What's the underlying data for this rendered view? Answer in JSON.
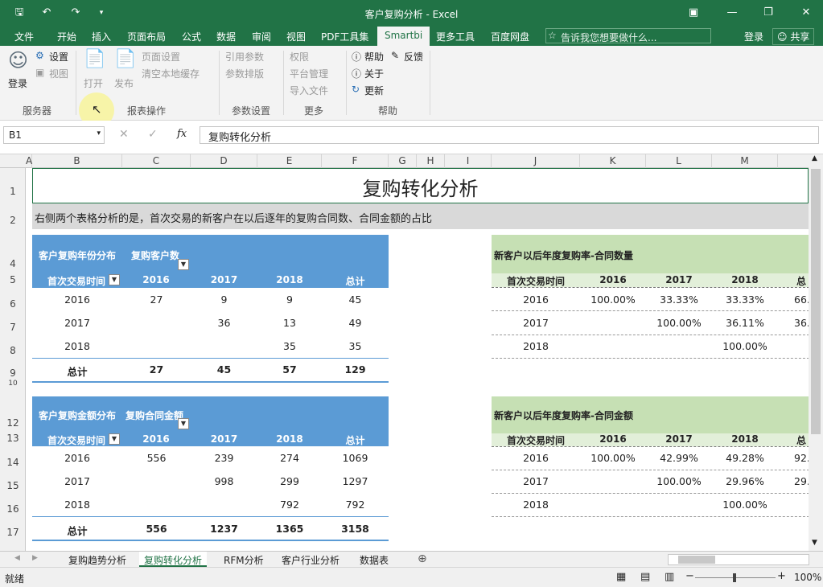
{
  "window": {
    "title": "客户复购分析 - Excel"
  },
  "tabs": [
    "文件",
    "开始",
    "插入",
    "页面布局",
    "公式",
    "数据",
    "审阅",
    "视图",
    "PDF工具集",
    "Smartbi",
    "更多工具",
    "百度网盘"
  ],
  "tellme_placeholder": "告诉我您想要做什么...",
  "account": {
    "login": "登录",
    "share": "共享"
  },
  "ribbon": {
    "login": "登录",
    "settings": "设置",
    "view": "视图",
    "open": "打开",
    "publish": "发布",
    "page_setup": "页面设置",
    "clear_cache": "清空本地缓存",
    "ref_params": "引用参数",
    "param_sort": "参数排版",
    "permission": "权限",
    "platform_mgmt": "平台管理",
    "import_file": "导入文件",
    "help": "帮助",
    "about": "关于",
    "update": "更新",
    "feedback": "反馈",
    "groups": [
      "服务器",
      "报表操作",
      "参数设置",
      "更多",
      "帮助"
    ]
  },
  "formula": {
    "name_box": "B1",
    "fx": "fx",
    "content": "复购转化分析"
  },
  "columns": [
    "A",
    "B",
    "C",
    "D",
    "E",
    "F",
    "G",
    "H",
    "I",
    "J",
    "K",
    "L",
    "M"
  ],
  "rows": [
    "1",
    "2",
    "4",
    "5",
    "6",
    "7",
    "8",
    "9",
    "10",
    "12",
    "13",
    "14",
    "15",
    "16",
    "17"
  ],
  "sheet": {
    "title": "复购转化分析",
    "desc": "右侧两个表格分析的是，首次交易的新客户在以后逐年的复购合同数、合同金额的占比",
    "t1": {
      "h1": "客户复购年份分布",
      "h2": "复购客户数",
      "rowlabel": "首次交易时间",
      "cols": [
        "2016",
        "2017",
        "2018",
        "总计"
      ],
      "rows": [
        [
          "2016",
          "27",
          "9",
          "9",
          "45"
        ],
        [
          "2017",
          "",
          "36",
          "13",
          "49"
        ],
        [
          "2018",
          "",
          "",
          "35",
          "35"
        ]
      ],
      "total": [
        "总计",
        "27",
        "45",
        "57",
        "129"
      ]
    },
    "t2": {
      "h1": "客户复购金额分布",
      "h2": "复购合同金额",
      "rowlabel": "首次交易时间",
      "cols": [
        "2016",
        "2017",
        "2018",
        "总计"
      ],
      "rows": [
        [
          "2016",
          "556",
          "239",
          "274",
          "1069"
        ],
        [
          "2017",
          "",
          "998",
          "299",
          "1297"
        ],
        [
          "2018",
          "",
          "",
          "792",
          "792"
        ]
      ],
      "total": [
        "总计",
        "556",
        "1237",
        "1365",
        "3158"
      ]
    },
    "t3": {
      "title": "新客户以后年度复购率-合同数量",
      "rowlabel": "首次交易时间",
      "cols": [
        "2016",
        "2017",
        "2018",
        "总"
      ],
      "rows": [
        [
          "2016",
          "100.00%",
          "33.33%",
          "33.33%",
          "66."
        ],
        [
          "2017",
          "",
          "100.00%",
          "36.11%",
          "36."
        ],
        [
          "2018",
          "",
          "",
          "100.00%",
          ""
        ]
      ]
    },
    "t4": {
      "title": "新客户以后年度复购率-合同金额",
      "rowlabel": "首次交易时间",
      "cols": [
        "2016",
        "2017",
        "2018",
        "总"
      ],
      "rows": [
        [
          "2016",
          "100.00%",
          "42.99%",
          "49.28%",
          "92."
        ],
        [
          "2017",
          "",
          "100.00%",
          "29.96%",
          "29."
        ],
        [
          "2018",
          "",
          "",
          "100.00%",
          ""
        ]
      ]
    }
  },
  "sheet_tabs": [
    "复购趋势分析",
    "复购转化分析",
    "RFM分析",
    "客户行业分析",
    "数据表"
  ],
  "status": {
    "ready": "就绪",
    "zoom": "100%"
  },
  "colors": {
    "excel_green": "#217346",
    "pivot_blue": "#5b9bd5",
    "pivot_green": "#c6e0b4"
  }
}
